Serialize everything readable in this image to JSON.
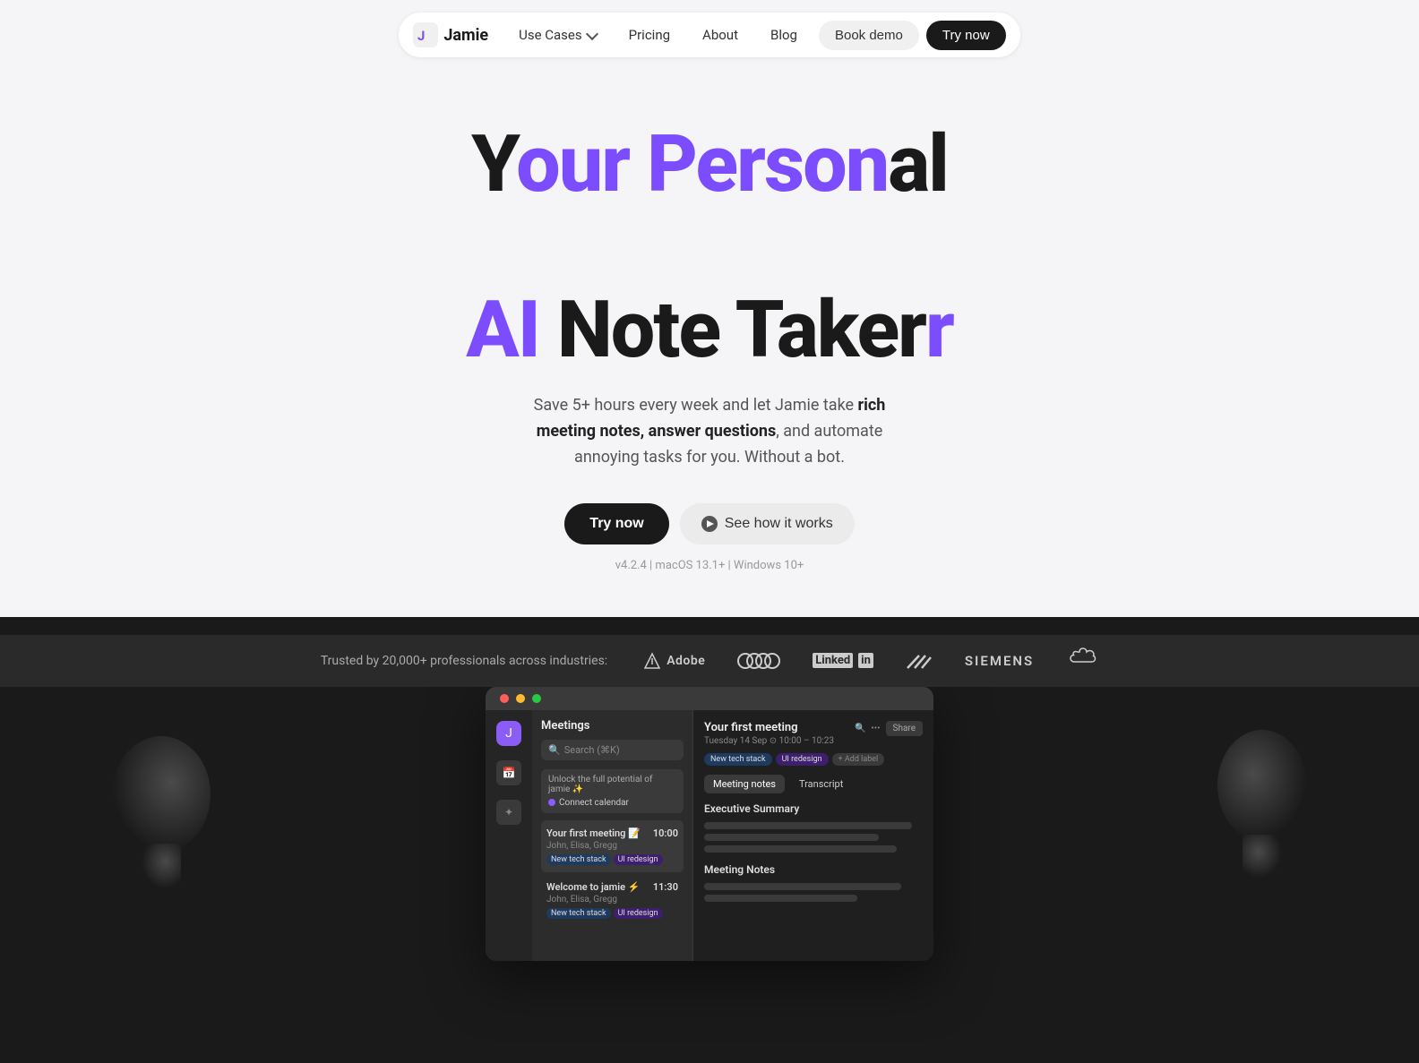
{
  "meta": {
    "title": "Jamie - Your Personal AI Note Taker"
  },
  "navbar": {
    "logo_text": "Jamie",
    "links": [
      {
        "label": "Use Cases",
        "has_dropdown": true
      },
      {
        "label": "Pricing"
      },
      {
        "label": "About"
      },
      {
        "label": "Blog"
      }
    ],
    "book_demo_label": "Book demo",
    "try_now_label": "Try now"
  },
  "hero": {
    "title_line1_plain": "Y",
    "title_line1_purple": "our Personal",
    "title_line2_purple": "AI Note Taker",
    "title_line1_full": "Your Personal",
    "title_line2_full": "AI Note Taker",
    "subtitle": "Save 5+ hours every week and let Jamie take rich meeting notes, answer questions, and automate annoying tasks for you. Without a bot.",
    "subtitle_bold1": "rich meeting notes, answer questions",
    "try_now_label": "Try now",
    "see_how_label": "See how it works",
    "version_info": "v4.2.4 | macOS 13.1+ | Windows 10+"
  },
  "trusted_bar": {
    "text": "Trusted by 20,000+ professionals across industries:",
    "brands": [
      "Adobe",
      "Audi",
      "LinkedIn",
      "Adidas",
      "Siemens",
      "Salesforce"
    ]
  },
  "app_demo": {
    "panel_title": "Meetings",
    "search_placeholder": "Search (⌘K)",
    "notification": "Unlock the full potential of jamie ✨",
    "connect_calendar": "Connect calendar",
    "meetings": [
      {
        "title": "Your first meeting 📝",
        "time": "10:00",
        "participants": "John, Elisa, Gregg",
        "tags": [
          "New tech stack",
          "UI redesign"
        ]
      },
      {
        "title": "Welcome to jamie ⚡",
        "time": "11:30",
        "participants": "John, Elisa, Gregg",
        "tags": [
          "New tech stack",
          "UI redesign"
        ]
      }
    ],
    "main_meeting_title": "Your first meeting",
    "main_meeting_date": "Tuesday 14 Sep",
    "main_meeting_time": "10:00 – 10:23",
    "label_tags": [
      "New tech stack",
      "UI redesign",
      "+ Add label"
    ],
    "tabs": [
      "Meeting notes",
      "Transcript"
    ],
    "sections": [
      {
        "title": "Executive Summary"
      },
      {
        "title": "Meeting Notes"
      }
    ]
  },
  "colors": {
    "brand_purple": "#7c4dff",
    "dark": "#1a1a1a",
    "light_bg": "#f5f5f7",
    "trusted_bg": "#2a2a2a"
  }
}
